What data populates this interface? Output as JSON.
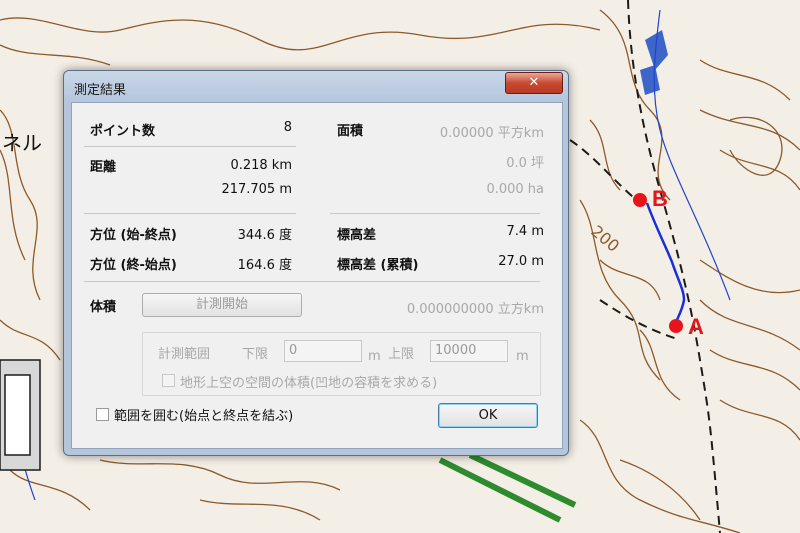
{
  "map": {
    "point_b_label": "B",
    "point_a_label": "A",
    "contour_label": "200",
    "tunnel_label": "ネル",
    "marker_color": "#e8141b",
    "route_color": "#1a2fd6",
    "contour_color": "#8b5a2b"
  },
  "dialog": {
    "title": "測定結果",
    "close_glyph": "✕",
    "points_label": "ポイント数",
    "points_value": "8",
    "area_label": "面積",
    "area_value_1": "0.00000 平方km",
    "area_value_2": "0.0 坪",
    "area_value_3": "0.000 ha",
    "distance_label": "距離",
    "distance_km": "0.218 km",
    "distance_m": "217.705 m",
    "bearing_start_end_label": "方位 (始-終点)",
    "bearing_start_end_value": "344.6 度",
    "bearing_end_start_label": "方位 (終-始点)",
    "bearing_end_start_value": "164.6 度",
    "elevation_diff_label": "標高差",
    "elevation_diff_value": "7.4 m",
    "elevation_cumulative_label": "標高差 (累積)",
    "elevation_cumulative_value": "27.0 m",
    "volume_label": "体積",
    "volume_button": "計測開始",
    "volume_value": "0.000000000 立方km",
    "range_label": "計測範囲",
    "lower_label": "下限",
    "lower_value": "0",
    "lower_unit": "m",
    "upper_label": "上限",
    "upper_value": "10000",
    "upper_unit": "m",
    "terrain_checkbox_label": "地形上空の空間の体積(凹地の容積を求める)",
    "enclose_checkbox_label": "範囲を囲む(始点と終点を結ぶ)",
    "ok_button": "OK"
  }
}
